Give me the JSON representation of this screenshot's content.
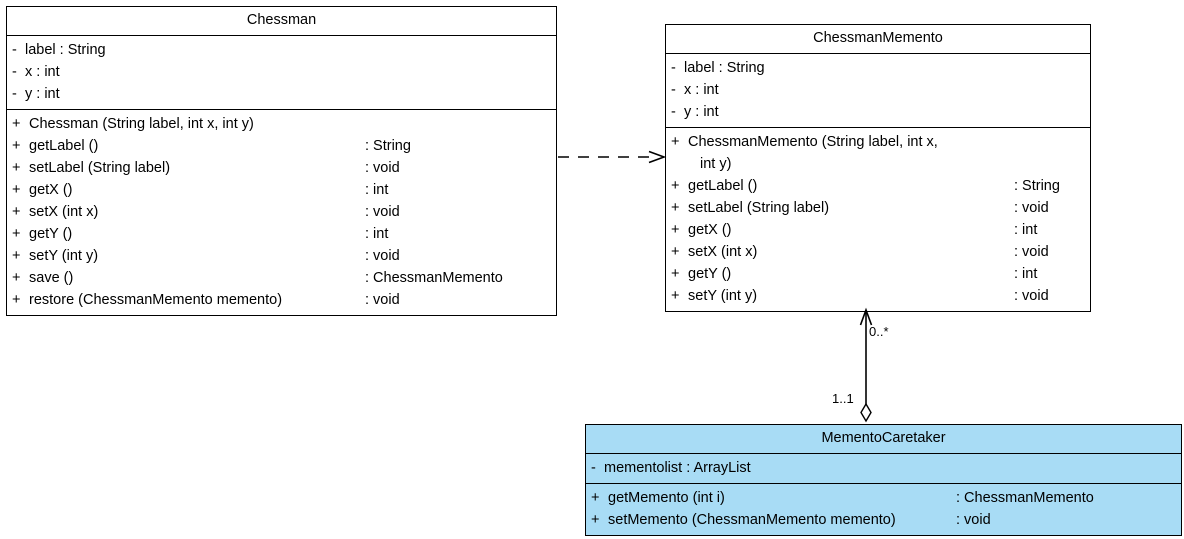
{
  "diagram": {
    "kind": "uml-class-diagram",
    "accent_fill": "#a8dcf5",
    "line_color": "#000000",
    "background": "#ffffff"
  },
  "classes": {
    "chessman": {
      "name": "Chessman",
      "attributes": [
        {
          "vis": "-",
          "sig": "label  : String"
        },
        {
          "vis": "-",
          "sig": "x        : int"
        },
        {
          "vis": "-",
          "sig": "y        : int"
        }
      ],
      "operations": [
        {
          "vis": "+",
          "sig": "Chessman (String label, int x, int y)",
          "ret": ""
        },
        {
          "vis": "+",
          "sig": "getLabel ()",
          "ret": ": String"
        },
        {
          "vis": "+",
          "sig": "setLabel (String label)",
          "ret": ": void"
        },
        {
          "vis": "+",
          "sig": "getX ()",
          "ret": ": int"
        },
        {
          "vis": "+",
          "sig": "setX (int x)",
          "ret": ": void"
        },
        {
          "vis": "+",
          "sig": "getY ()",
          "ret": ": int"
        },
        {
          "vis": "+",
          "sig": "setY (int y)",
          "ret": ": void"
        },
        {
          "vis": "+",
          "sig": "save ()",
          "ret": ": ChessmanMemento"
        },
        {
          "vis": "+",
          "sig": "restore (ChessmanMemento memento)",
          "ret": ": void"
        }
      ]
    },
    "chessman_memento": {
      "name": "ChessmanMemento",
      "attributes": [
        {
          "vis": "-",
          "sig": "label  : String"
        },
        {
          "vis": "-",
          "sig": "x        : int"
        },
        {
          "vis": "-",
          "sig": "y        : int"
        }
      ],
      "operations": [
        {
          "vis": "+",
          "sig": "ChessmanMemento (String label, int x,",
          "sig2": "int y)",
          "ret": ""
        },
        {
          "vis": "+",
          "sig": "getLabel ()",
          "ret": ": String"
        },
        {
          "vis": "+",
          "sig": "setLabel (String label)",
          "ret": ": void"
        },
        {
          "vis": "+",
          "sig": "getX ()",
          "ret": ": int"
        },
        {
          "vis": "+",
          "sig": "setX (int x)",
          "ret": ": void"
        },
        {
          "vis": "+",
          "sig": "getY ()",
          "ret": ": int"
        },
        {
          "vis": "+",
          "sig": "setY (int y)",
          "ret": ": void"
        }
      ]
    },
    "memento_caretaker": {
      "name": "MementoCaretaker",
      "attributes": [
        {
          "vis": "-",
          "sig": "mementolist  : ArrayList"
        }
      ],
      "operations": [
        {
          "vis": "+",
          "sig": "getMemento (int i)",
          "ret": ": ChessmanMemento"
        },
        {
          "vis": "+",
          "sig": "setMemento (ChessmanMemento memento)",
          "ret": ": void"
        }
      ]
    }
  },
  "relations": {
    "dependency": {
      "name": "dependency",
      "style": "dashed-open-arrow",
      "from": "Chessman",
      "to": "ChessmanMemento"
    },
    "aggregation": {
      "name": "aggregation",
      "style": "solid-open-arrow-hollow-diamond",
      "from": "MementoCaretaker",
      "to": "ChessmanMemento",
      "target_multiplicity": "0..*",
      "source_multiplicity": "1..1"
    }
  }
}
